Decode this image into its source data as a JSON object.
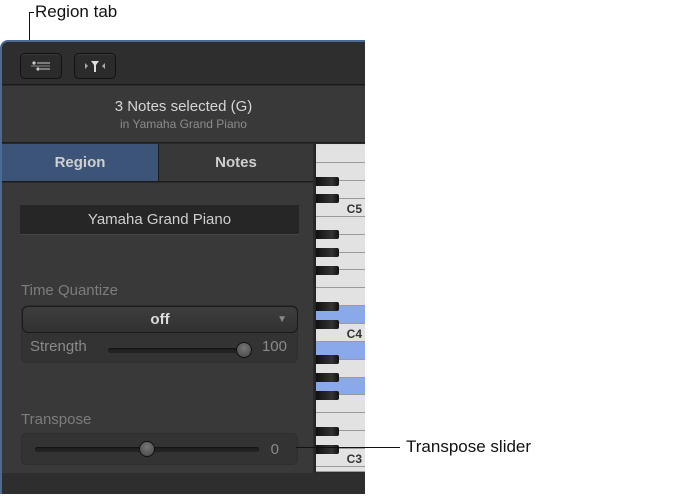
{
  "callouts": {
    "region_tab": "Region tab",
    "transpose_slider": "Transpose slider"
  },
  "header": {
    "title": "3 Notes selected (G)",
    "subtitle": "in Yamaha Grand Piano"
  },
  "tabs": [
    {
      "label": "Region",
      "active": true
    },
    {
      "label": "Notes",
      "active": false
    }
  ],
  "region": {
    "instrument": "Yamaha Grand Piano",
    "time_quantize": {
      "label": "Time Quantize",
      "value": "off",
      "strength_label": "Strength",
      "strength": 100,
      "strength_max": 100
    },
    "transpose": {
      "label": "Transpose",
      "value": 0,
      "min": -36,
      "max": 36
    }
  },
  "keyboard": {
    "labels": [
      "C5",
      "C4",
      "C3"
    ],
    "selected_notes": [
      "D4",
      "B3",
      "G3"
    ]
  },
  "colors": {
    "accent": "#3b5478",
    "selected_key": "#8aa9ea"
  }
}
